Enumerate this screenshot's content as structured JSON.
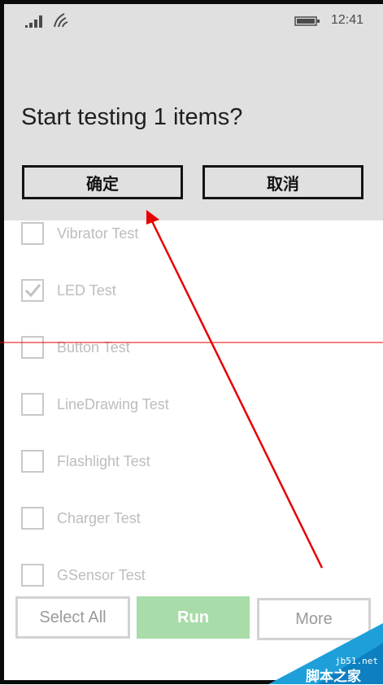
{
  "status_bar": {
    "time": "12:41",
    "signal_icon": "signal-bars-icon",
    "wifi_icon": "wifi-icon",
    "battery_icon": "battery-icon"
  },
  "dialog": {
    "title": "Start testing 1 items?",
    "ok_label": "确定",
    "cancel_label": "取消"
  },
  "tests": [
    {
      "label": "Vibrator Test",
      "checked": false
    },
    {
      "label": "LED Test",
      "checked": true
    },
    {
      "label": "Button Test",
      "checked": false
    },
    {
      "label": "LineDrawing Test",
      "checked": false
    },
    {
      "label": "Flashlight Test",
      "checked": false
    },
    {
      "label": "Charger Test",
      "checked": false
    },
    {
      "label": "GSensor Test",
      "checked": false
    }
  ],
  "buttons": {
    "select_all": "Select All",
    "run": "Run",
    "more": "More"
  },
  "watermark": {
    "site": "jb51.net",
    "brand": "脚本之家"
  },
  "colors": {
    "dialog_bg": "#e0e0e0",
    "run_bg": "#a8dca8",
    "annotation": "#e60000"
  }
}
